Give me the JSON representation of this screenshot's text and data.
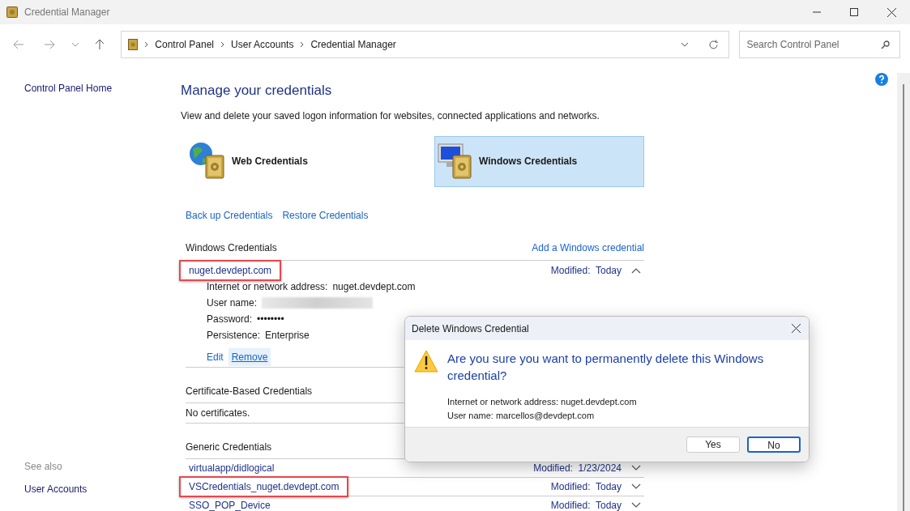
{
  "window": {
    "title": "Credential Manager"
  },
  "address_bar": {
    "crumbs": [
      "Control Panel",
      "User Accounts",
      "Credential Manager"
    ]
  },
  "search": {
    "placeholder": "Search Control Panel"
  },
  "sidebar": {
    "home": "Control Panel Home",
    "see_also_title": "See also",
    "see_also": [
      "User Accounts"
    ]
  },
  "main": {
    "title": "Manage your credentials",
    "description": "View and delete your saved logon information for websites, connected applications and networks.",
    "tiles": [
      {
        "kind": "web",
        "label": "Web Credentials",
        "selected": false
      },
      {
        "kind": "windows",
        "label": "Windows Credentials",
        "selected": true
      }
    ],
    "links": [
      "Back up Credentials",
      "Restore Credentials"
    ],
    "sections": [
      {
        "title": "Windows Credentials",
        "action": "Add a Windows credential",
        "items": [
          {
            "name": "nuget.devdept.com",
            "modified_label": "Modified:",
            "modified": "Today",
            "expanded": true,
            "highlighted": true,
            "details": [
              {
                "kind": "text",
                "label": "Internet or network address:",
                "value": "nuget.devdept.com"
              },
              {
                "kind": "redacted",
                "label": "User name:"
              },
              {
                "kind": "text",
                "label": "Password:",
                "value": "••••••••"
              },
              {
                "kind": "text",
                "label": "Persistence:",
                "value": "Enterprise"
              }
            ],
            "actions": [
              {
                "label": "Edit",
                "hovered": false
              },
              {
                "label": "Remove",
                "hovered": true
              }
            ]
          }
        ]
      },
      {
        "title": "Certificate-Based Credentials",
        "empty_text": "No certificates."
      },
      {
        "title": "Generic Credentials",
        "items": [
          {
            "name": "virtualapp/didlogical",
            "modified_label": "Modified:",
            "modified": "1/23/2024",
            "expanded": false,
            "highlighted": false
          },
          {
            "name": "VSCredentials_nuget.devdept.com",
            "modified_label": "Modified:",
            "modified": "Today",
            "expanded": false,
            "highlighted": true
          },
          {
            "name": "SSO_POP_Device",
            "modified_label": "Modified:",
            "modified": "Today",
            "expanded": false,
            "highlighted": false
          }
        ]
      }
    ]
  },
  "dialog": {
    "title": "Delete Windows Credential",
    "question": "Are you sure you want to permanently delete this Windows credential?",
    "lines": [
      "Internet or network address: nuget.devdept.com",
      "User name: marcellos@devdept.com"
    ],
    "buttons": [
      {
        "label": "Yes",
        "default": false
      },
      {
        "label": "No",
        "default": true
      }
    ]
  }
}
